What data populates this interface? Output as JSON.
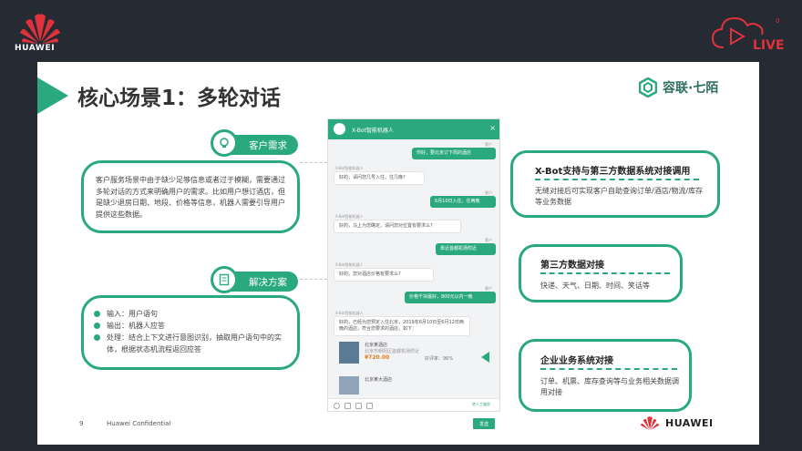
{
  "header": {
    "huawei_logo_text": "HUAWEI",
    "live_badge": "LIVE",
    "live_count": "0"
  },
  "slide": {
    "title": "核心场景1：多轮对话",
    "brand": "容联·七陌",
    "accent_color": "#2aa87e",
    "left": {
      "need": {
        "label": "客户需求",
        "text": "客户服务场景中由于缺少足够信息或者过于模糊，需要通过多轮对话的方式来明确用户的需求。比如用户想订酒店，但是缺少退房日期、地段、价格等信息，机器人需要引导用户提供这些数据。"
      },
      "solution": {
        "label": "解决方案",
        "items": [
          "输入：用户语句",
          "输出：机器人应答",
          "处理：结合上下文进行意图识别，抽取用户语句中的实体，根据状态机流程返回应答"
        ]
      }
    },
    "chat": {
      "header": "X-Bot智能机器人",
      "close": "×",
      "messages": [
        {
          "side": "r",
          "meta": "客户",
          "text": "你好，要北京订下周的酒店"
        },
        {
          "side": "l",
          "meta": "X-Bot智能机器人",
          "text": "好的，请问您几号入住，住几晚?"
        },
        {
          "side": "r",
          "meta": "客户",
          "text": "6月10日入住，住两晚"
        },
        {
          "side": "l",
          "meta": "X-Bot智能机器人",
          "text": "好的，马上为您确定。请问您对位置有要求么?"
        },
        {
          "side": "r",
          "meta": "客户",
          "text": "靠近首都机场附近"
        },
        {
          "side": "l",
          "meta": "X-Bot智能机器人",
          "text": "好的，您对酒店价格有要求么?"
        },
        {
          "side": "r",
          "meta": "客户",
          "text": "价格千块最好，800元以内一晚"
        },
        {
          "side": "l",
          "meta": "X-Bot智能机器人",
          "text": "好的，已经为您预定入住北京，2019年6月10日至6月12日两晚的酒店，符合您要求的酒店，如下："
        }
      ],
      "hotels": [
        {
          "name": "北京某酒店",
          "addr": "北京市朝阳区首都机场附近",
          "price": "¥720.00",
          "rate": "好评率：96%"
        },
        {
          "name": "北京某大酒店",
          "addr": "",
          "price": "",
          "rate": ""
        }
      ],
      "transfer": "转人工服务",
      "send": "发送"
    },
    "right": [
      {
        "title": "X-Bot支持与第三方数据系统对接调用",
        "text": "无缝对接后可实现客户自助查询订单/酒店/物流/库存等业务数据"
      },
      {
        "title": "第三方数据对接",
        "text": "快递、天气、日期、时间、笑话等"
      },
      {
        "title": "企业业务系统对接",
        "text": "订单、机票、库存查询等与业务相关数据调用对接"
      }
    ],
    "footer": {
      "page": "9",
      "confidential": "Huawei Confidential",
      "huawei": "HUAWEI"
    }
  }
}
